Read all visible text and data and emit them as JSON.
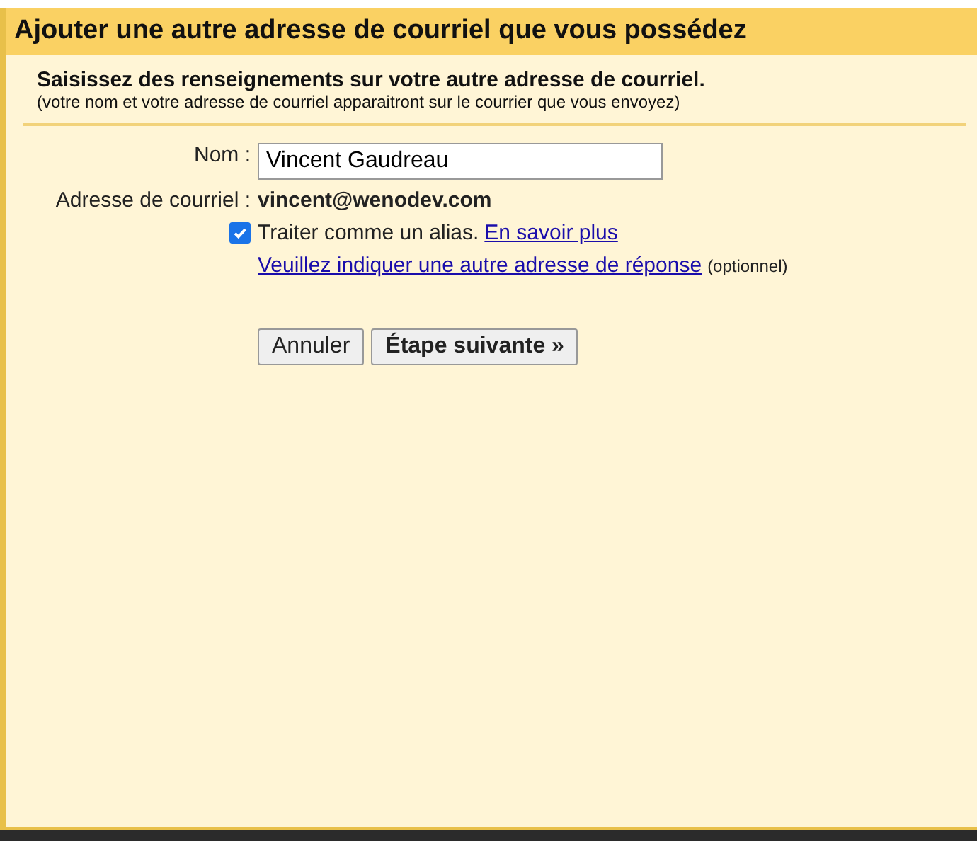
{
  "dialog": {
    "title": "Ajouter une autre adresse de courriel que vous possédez"
  },
  "intro": {
    "heading": "Saisissez des renseignements sur votre autre adresse de courriel.",
    "note": "(votre nom et votre adresse de courriel apparaitront sur le courrier que vous envoyez)"
  },
  "form": {
    "name_label": "Nom :",
    "name_value": "Vincent Gaudreau",
    "email_label": "Adresse de courriel :",
    "email_value": "vincent@wenodev.com",
    "alias": {
      "label": "Traiter comme un alias.",
      "checked": true,
      "link": "En savoir plus"
    },
    "reply_link": "Veuillez indiquer une autre adresse de réponse",
    "reply_note": "(optionnel)"
  },
  "buttons": [
    {
      "label": "Annuler",
      "kind": "secondary"
    },
    {
      "label": "Étape suivante »",
      "kind": "primary"
    }
  ]
}
